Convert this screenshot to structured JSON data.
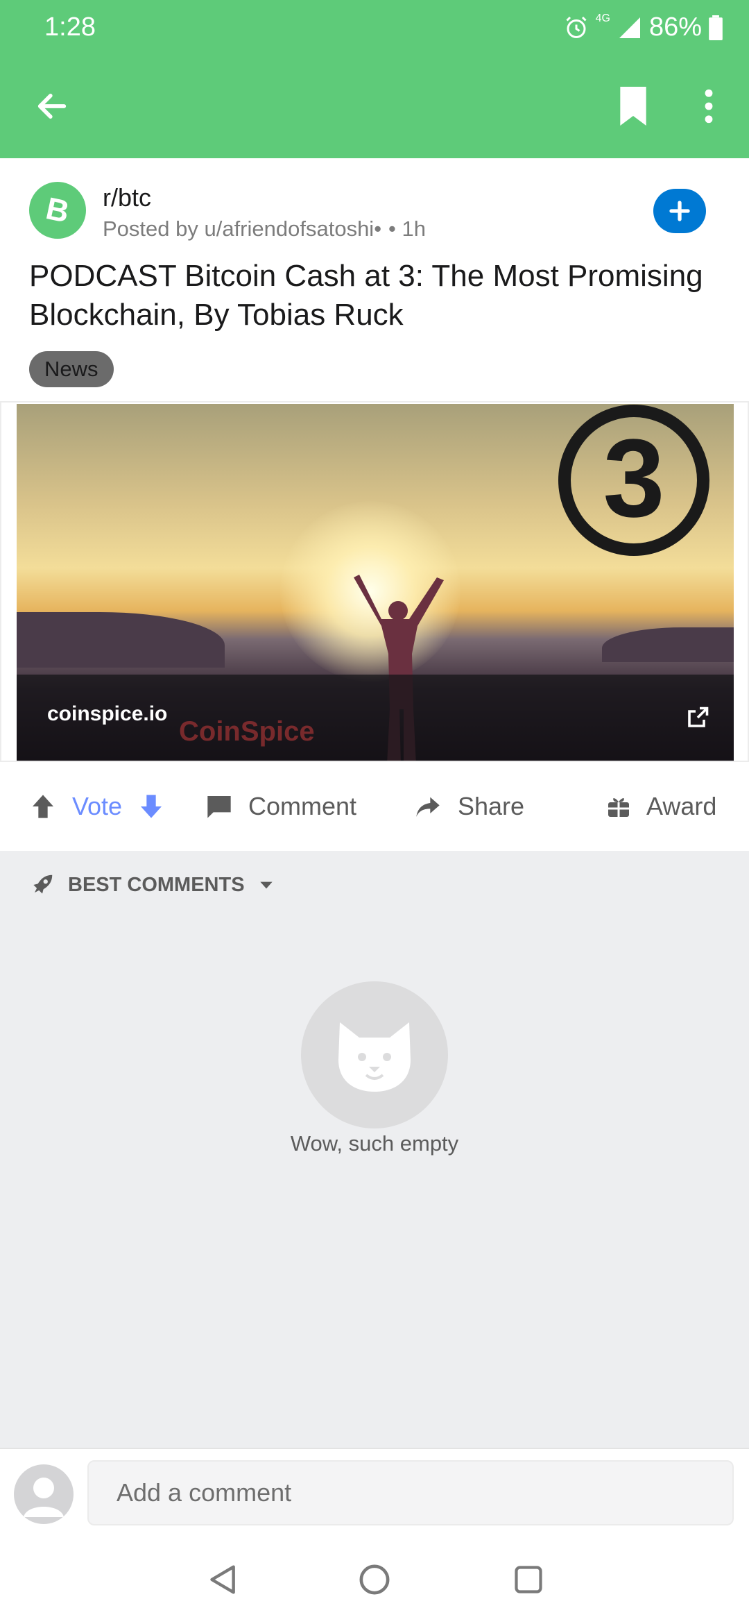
{
  "status_bar": {
    "time": "1:28",
    "network": "4G",
    "battery": "86%"
  },
  "app_bar": {
    "back_icon": "arrow-left-icon",
    "bookmark_icon": "bookmark-icon",
    "more_icon": "more-vert-icon"
  },
  "post": {
    "subreddit": "r/btc",
    "posted_by": "Posted by u/afriendofsatoshi•",
    "age": "• 1h",
    "title": "PODCAST Bitcoin Cash at 3: The Most Promising Blockchain, By Tobias Ruck",
    "flair": "News",
    "preview_domain": "coinspice.io",
    "preview_watermark": "CoinSpice",
    "colors": {
      "accent": "#5ecb79",
      "join": "#0079d3",
      "vote": "#6b8cff"
    }
  },
  "actions": {
    "vote": "Vote",
    "comment": "Comment",
    "share": "Share",
    "award": "Award"
  },
  "comments": {
    "sort_label": "BEST COMMENTS",
    "empty_text": "Wow, such empty"
  },
  "comment_input": {
    "placeholder": "Add a comment"
  }
}
